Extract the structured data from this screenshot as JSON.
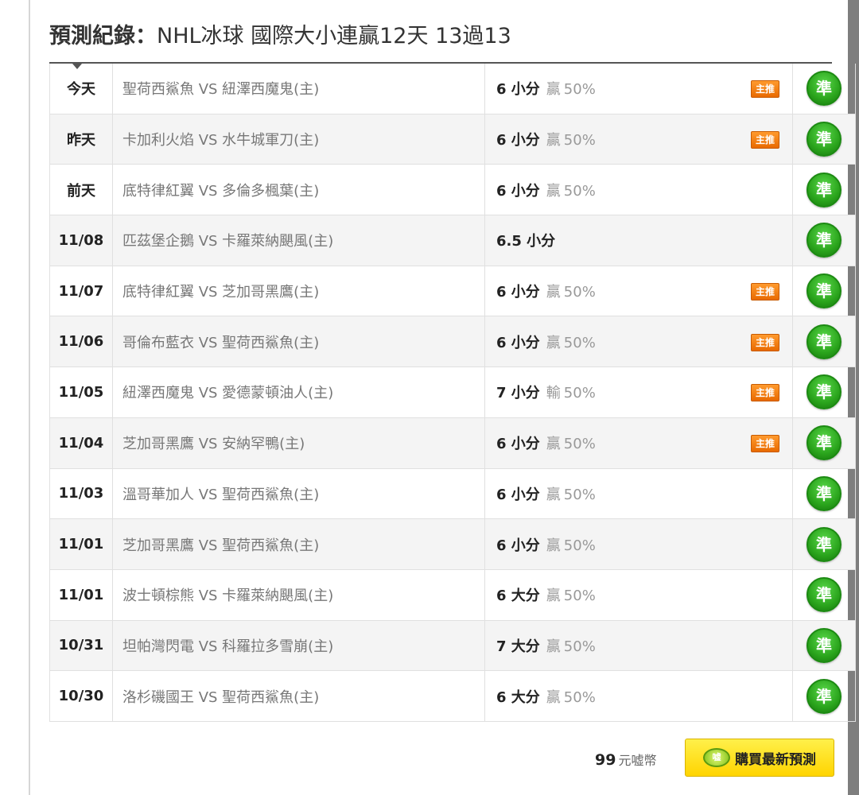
{
  "header": {
    "title_lead": "預測紀錄：",
    "title_rest": "NHL冰球 國際大小連贏12天 13過13"
  },
  "records": [
    {
      "date": "今天",
      "match": "聖荷西鯊魚 VS 紐澤西魔鬼(主)",
      "pick": "6 小分",
      "result": "贏",
      "pct": "50%",
      "badge": "主推",
      "mark": "準"
    },
    {
      "date": "昨天",
      "match": "卡加利火焰 VS 水牛城軍刀(主)",
      "pick": "6 小分",
      "result": "贏",
      "pct": "50%",
      "badge": "主推",
      "mark": "準"
    },
    {
      "date": "前天",
      "match": "底特律紅翼 VS 多倫多楓葉(主)",
      "pick": "6 小分",
      "result": "贏",
      "pct": "50%",
      "badge": "",
      "mark": "準"
    },
    {
      "date": "11/08",
      "match": "匹茲堡企鵝 VS 卡羅萊納颶風(主)",
      "pick": "6.5 小分",
      "result": "",
      "pct": "",
      "badge": "",
      "mark": "準"
    },
    {
      "date": "11/07",
      "match": "底特律紅翼 VS 芝加哥黑鷹(主)",
      "pick": "6 小分",
      "result": "贏",
      "pct": "50%",
      "badge": "主推",
      "mark": "準"
    },
    {
      "date": "11/06",
      "match": "哥倫布藍衣 VS 聖荷西鯊魚(主)",
      "pick": "6 小分",
      "result": "贏",
      "pct": "50%",
      "badge": "主推",
      "mark": "準"
    },
    {
      "date": "11/05",
      "match": "紐澤西魔鬼 VS 愛德蒙頓油人(主)",
      "pick": "7 小分",
      "result": "輸",
      "pct": "50%",
      "badge": "主推",
      "mark": "準"
    },
    {
      "date": "11/04",
      "match": "芝加哥黑鷹 VS 安納罕鴨(主)",
      "pick": "6 小分",
      "result": "贏",
      "pct": "50%",
      "badge": "主推",
      "mark": "準"
    },
    {
      "date": "11/03",
      "match": "溫哥華加人 VS 聖荷西鯊魚(主)",
      "pick": "6 小分",
      "result": "贏",
      "pct": "50%",
      "badge": "",
      "mark": "準"
    },
    {
      "date": "11/01",
      "match": "芝加哥黑鷹 VS 聖荷西鯊魚(主)",
      "pick": "6 小分",
      "result": "贏",
      "pct": "50%",
      "badge": "",
      "mark": "準"
    },
    {
      "date": "11/01",
      "match": "波士頓棕熊 VS 卡羅萊納颶風(主)",
      "pick": "6 大分",
      "result": "贏",
      "pct": "50%",
      "badge": "",
      "mark": "準"
    },
    {
      "date": "10/31",
      "match": "坦帕灣閃電 VS 科羅拉多雪崩(主)",
      "pick": "7 大分",
      "result": "贏",
      "pct": "50%",
      "badge": "",
      "mark": "準"
    },
    {
      "date": "10/30",
      "match": "洛杉磯國王 VS 聖荷西鯊魚(主)",
      "pick": "6 大分",
      "result": "贏",
      "pct": "50%",
      "badge": "",
      "mark": "準"
    }
  ],
  "footer": {
    "price_amount": "99",
    "price_unit": "元嘘幣",
    "buy_button_label": "購買最新預測",
    "coin_text": "嘘"
  },
  "colors": {
    "mark_green": "#2aa41c",
    "badge_orange": "#f07a10",
    "buy_yellow": "#ffe31a"
  }
}
